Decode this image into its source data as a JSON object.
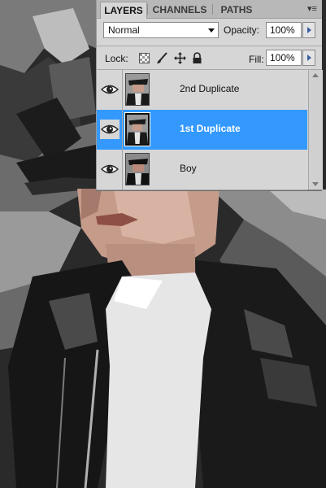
{
  "panel": {
    "tabs": [
      {
        "label": "LAYERS",
        "active": true
      },
      {
        "label": "CHANNELS",
        "active": false
      },
      {
        "label": "PATHS",
        "active": false
      }
    ],
    "blend_mode": "Normal",
    "opacity_label": "Opacity:",
    "opacity_value": "100%",
    "lock_label": "Lock:",
    "fill_label": "Fill:",
    "fill_value": "100%",
    "icons": {
      "menu": "panel-menu-icon",
      "lock_transparent": "checkerboard-lock-icon",
      "lock_image": "brush-lock-icon",
      "lock_position": "move-lock-icon",
      "lock_all": "padlock-icon"
    },
    "layers": [
      {
        "name": "2nd Duplicate",
        "visible": true,
        "selected": false
      },
      {
        "name": "1st Duplicate",
        "visible": true,
        "selected": true
      },
      {
        "name": "Boy",
        "visible": true,
        "selected": false
      }
    ],
    "colors": {
      "selection": "#3399ff",
      "panel_bg": "#d6d6d6"
    }
  }
}
